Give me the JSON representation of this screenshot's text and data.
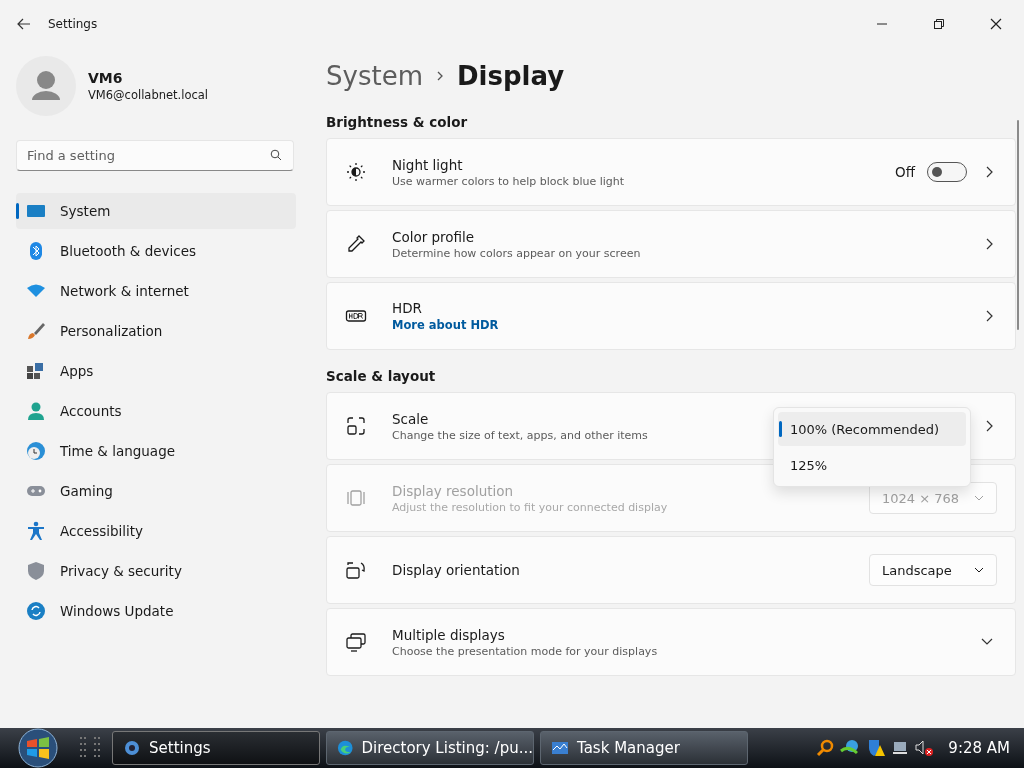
{
  "window": {
    "title": "Settings"
  },
  "user": {
    "name": "VM6",
    "email": "VM6@collabnet.local"
  },
  "search": {
    "placeholder": "Find a setting"
  },
  "nav": [
    {
      "label": "System",
      "selected": true
    },
    {
      "label": "Bluetooth & devices",
      "selected": false
    },
    {
      "label": "Network & internet",
      "selected": false
    },
    {
      "label": "Personalization",
      "selected": false
    },
    {
      "label": "Apps",
      "selected": false
    },
    {
      "label": "Accounts",
      "selected": false
    },
    {
      "label": "Time & language",
      "selected": false
    },
    {
      "label": "Gaming",
      "selected": false
    },
    {
      "label": "Accessibility",
      "selected": false
    },
    {
      "label": "Privacy & security",
      "selected": false
    },
    {
      "label": "Windows Update",
      "selected": false
    }
  ],
  "breadcrumb": {
    "parent": "System",
    "current": "Display"
  },
  "sections": [
    {
      "title": "Brightness & color",
      "cards": [
        {
          "kind": "toggle",
          "title": "Night light",
          "subtitle": "Use warmer colors to help block blue light",
          "state_label": "Off",
          "on": false,
          "disabled": false
        },
        {
          "kind": "nav",
          "title": "Color profile",
          "subtitle": "Determine how colors appear on your screen",
          "disabled": false
        },
        {
          "kind": "link",
          "title": "HDR",
          "link": "More about HDR",
          "disabled": false
        }
      ]
    },
    {
      "title": "Scale & layout",
      "cards": [
        {
          "kind": "menu",
          "title": "Scale",
          "subtitle": "Change the size of text, apps, and other items",
          "disabled": false,
          "options": [
            {
              "label": "100% (Recommended)",
              "selected": true
            },
            {
              "label": "125%",
              "selected": false
            }
          ]
        },
        {
          "kind": "dropdown",
          "title": "Display resolution",
          "subtitle": "Adjust the resolution to fit your connected display",
          "value": "1024 × 768",
          "disabled": true
        },
        {
          "kind": "dropdown",
          "title": "Display orientation",
          "value": "Landscape",
          "disabled": false
        },
        {
          "kind": "expander",
          "title": "Multiple displays",
          "subtitle": "Choose the presentation mode for your displays",
          "disabled": false
        }
      ]
    }
  ],
  "taskbar": {
    "buttons": [
      {
        "label": "Settings",
        "active": true
      },
      {
        "label": "Directory Listing: /pu...",
        "active": false
      },
      {
        "label": "Task Manager",
        "active": false
      }
    ],
    "time": "9:28 AM"
  }
}
